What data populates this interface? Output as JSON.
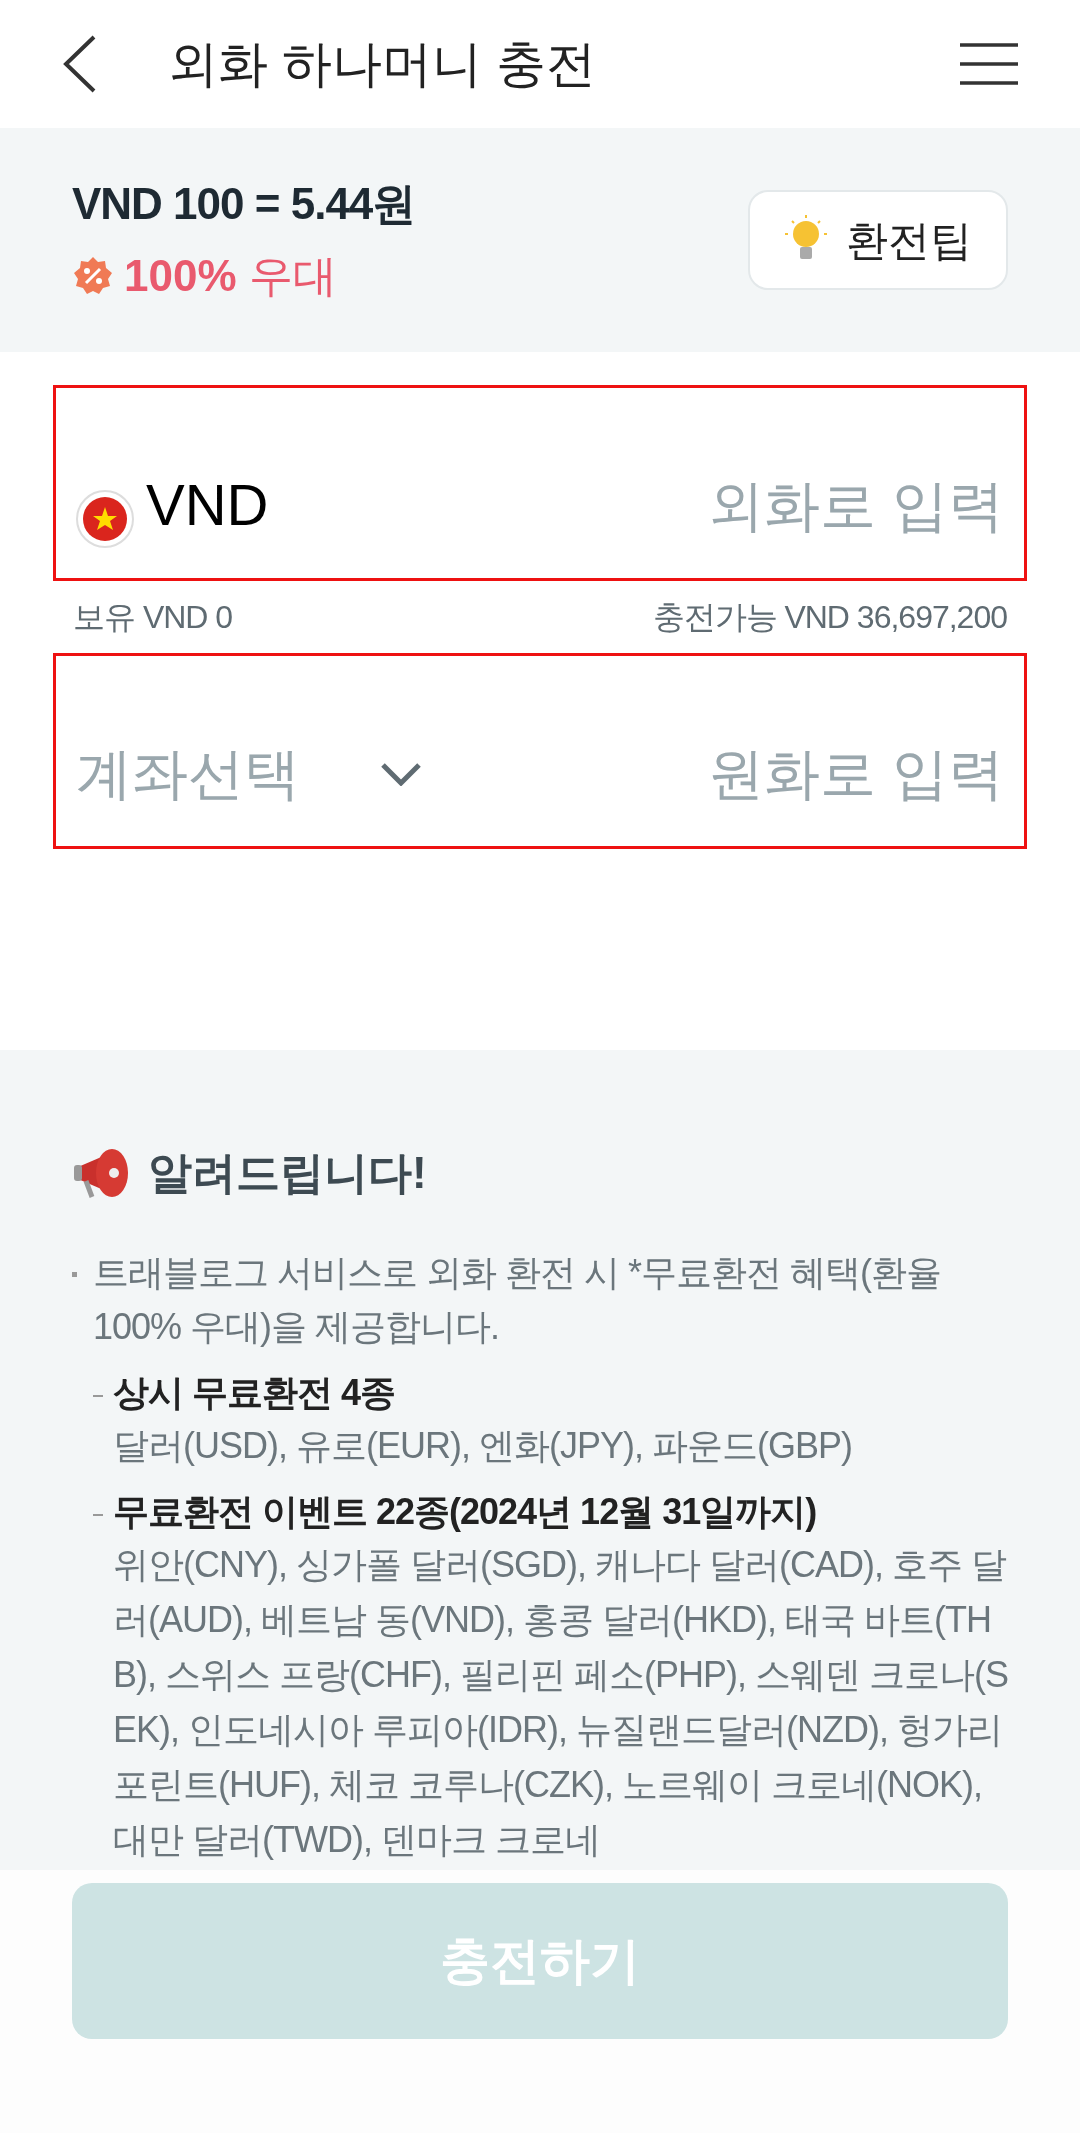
{
  "header": {
    "title": "외화 하나머니 충전"
  },
  "rate": {
    "text": "VND 100 = 5.44원",
    "benefit": "**100%** 우대",
    "tip_button": "환전팁"
  },
  "foreign_field": {
    "currency": "VND",
    "placeholder": "외화로 입력"
  },
  "balance": {
    "held": "보유 VND 0",
    "available": "충전가능 VND 36,697,200"
  },
  "krw_field": {
    "account_placeholder": "계좌선택",
    "placeholder": "원화로 입력"
  },
  "notice": {
    "title": "알려드립니다!",
    "items": [
      {
        "text": "트래블로그 서비스로 외화 환전 시 *무료환전 혜택(환율 100% 우대)을 제공합니다.",
        "children": [
          {
            "title": "상시 무료환전 4종",
            "text": "달러(USD), 유로(EUR), 엔화(JPY), 파운드(GBP)"
          },
          {
            "title": "무료환전 이벤트 22종(2024년 12월 31일까지)",
            "text": "위안(CNY), 싱가폴 달러(SGD), 캐나다 달러(CAD), 호주 달러(AUD), 베트남 동(VND), 홍콩 달러(HKD), 태국 바트(THB), 스위스 프랑(CHF), 필리핀 페소(PHP), 스웨덴 크로나(SEK), 인도네시아 루피아(IDR), 뉴질랜드달러(NZD), 헝가리 포린트(HUF), 체코 코루나(CZK), 노르웨이 크로네(NOK), 대만 달러(TWD), 덴마크 크로네"
          }
        ]
      }
    ]
  },
  "charge_button": {
    "label": "충전하기",
    "disabled": true
  }
}
